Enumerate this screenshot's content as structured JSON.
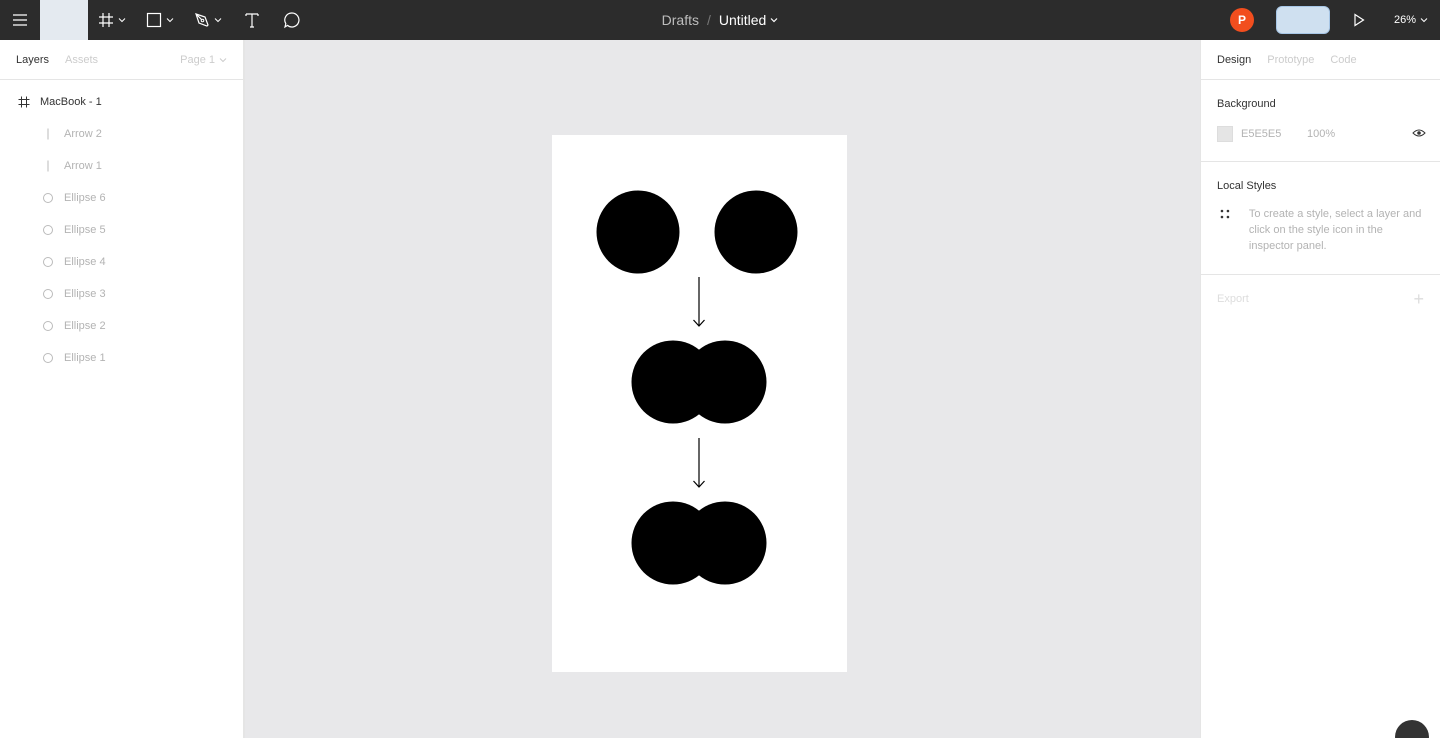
{
  "toolbar": {
    "menu_icon": "hamburger-icon",
    "move_tool_icon": "move-tool-icon",
    "frame_tool_icon": "frame-tool-icon",
    "shape_tool_icon": "rectangle-tool-icon",
    "pen_tool_icon": "pen-tool-icon",
    "text_tool_icon": "text-tool-icon",
    "comment_tool_icon": "comment-tool-icon"
  },
  "breadcrumb": {
    "folder": "Drafts",
    "separator": "/",
    "file": "Untitled"
  },
  "user": {
    "avatar_initial": "P",
    "avatar_color": "#f24e1e"
  },
  "zoom": "26%",
  "left_panel": {
    "tabs": [
      {
        "label": "Layers",
        "active": true
      },
      {
        "label": "Assets",
        "active": false
      }
    ],
    "page": "Page 1",
    "layers": [
      {
        "name": "MacBook - 1",
        "type": "frame",
        "icon": "frame-icon"
      },
      {
        "name": "Arrow 2",
        "type": "line",
        "icon": "line-icon"
      },
      {
        "name": "Arrow 1",
        "type": "line",
        "icon": "line-icon"
      },
      {
        "name": "Ellipse 6",
        "type": "ellipse",
        "icon": "ellipse-icon"
      },
      {
        "name": "Ellipse 5",
        "type": "ellipse",
        "icon": "ellipse-icon"
      },
      {
        "name": "Ellipse 4",
        "type": "ellipse",
        "icon": "ellipse-icon"
      },
      {
        "name": "Ellipse 3",
        "type": "ellipse",
        "icon": "ellipse-icon"
      },
      {
        "name": "Ellipse 2",
        "type": "ellipse",
        "icon": "ellipse-icon"
      },
      {
        "name": "Ellipse 1",
        "type": "ellipse",
        "icon": "ellipse-icon"
      }
    ]
  },
  "right_panel": {
    "tabs": [
      {
        "label": "Design",
        "active": true
      },
      {
        "label": "Prototype",
        "active": false
      },
      {
        "label": "Code",
        "active": false
      }
    ],
    "background": {
      "title": "Background",
      "hex": "E5E5E5",
      "opacity": "100%",
      "color": "#e5e5e5"
    },
    "local_styles": {
      "title": "Local Styles",
      "hint": "To create a style, select a layer and click on the style icon in the inspector panel."
    },
    "export": {
      "title": "Export",
      "add_symbol": "+"
    }
  },
  "colors": {
    "toolbar_bg": "#2c2c2c",
    "canvas_bg": "#e8e8ea",
    "frame_bg": "#ffffff",
    "shape_fill": "#000000",
    "accent_share": "#cfe0f0"
  }
}
